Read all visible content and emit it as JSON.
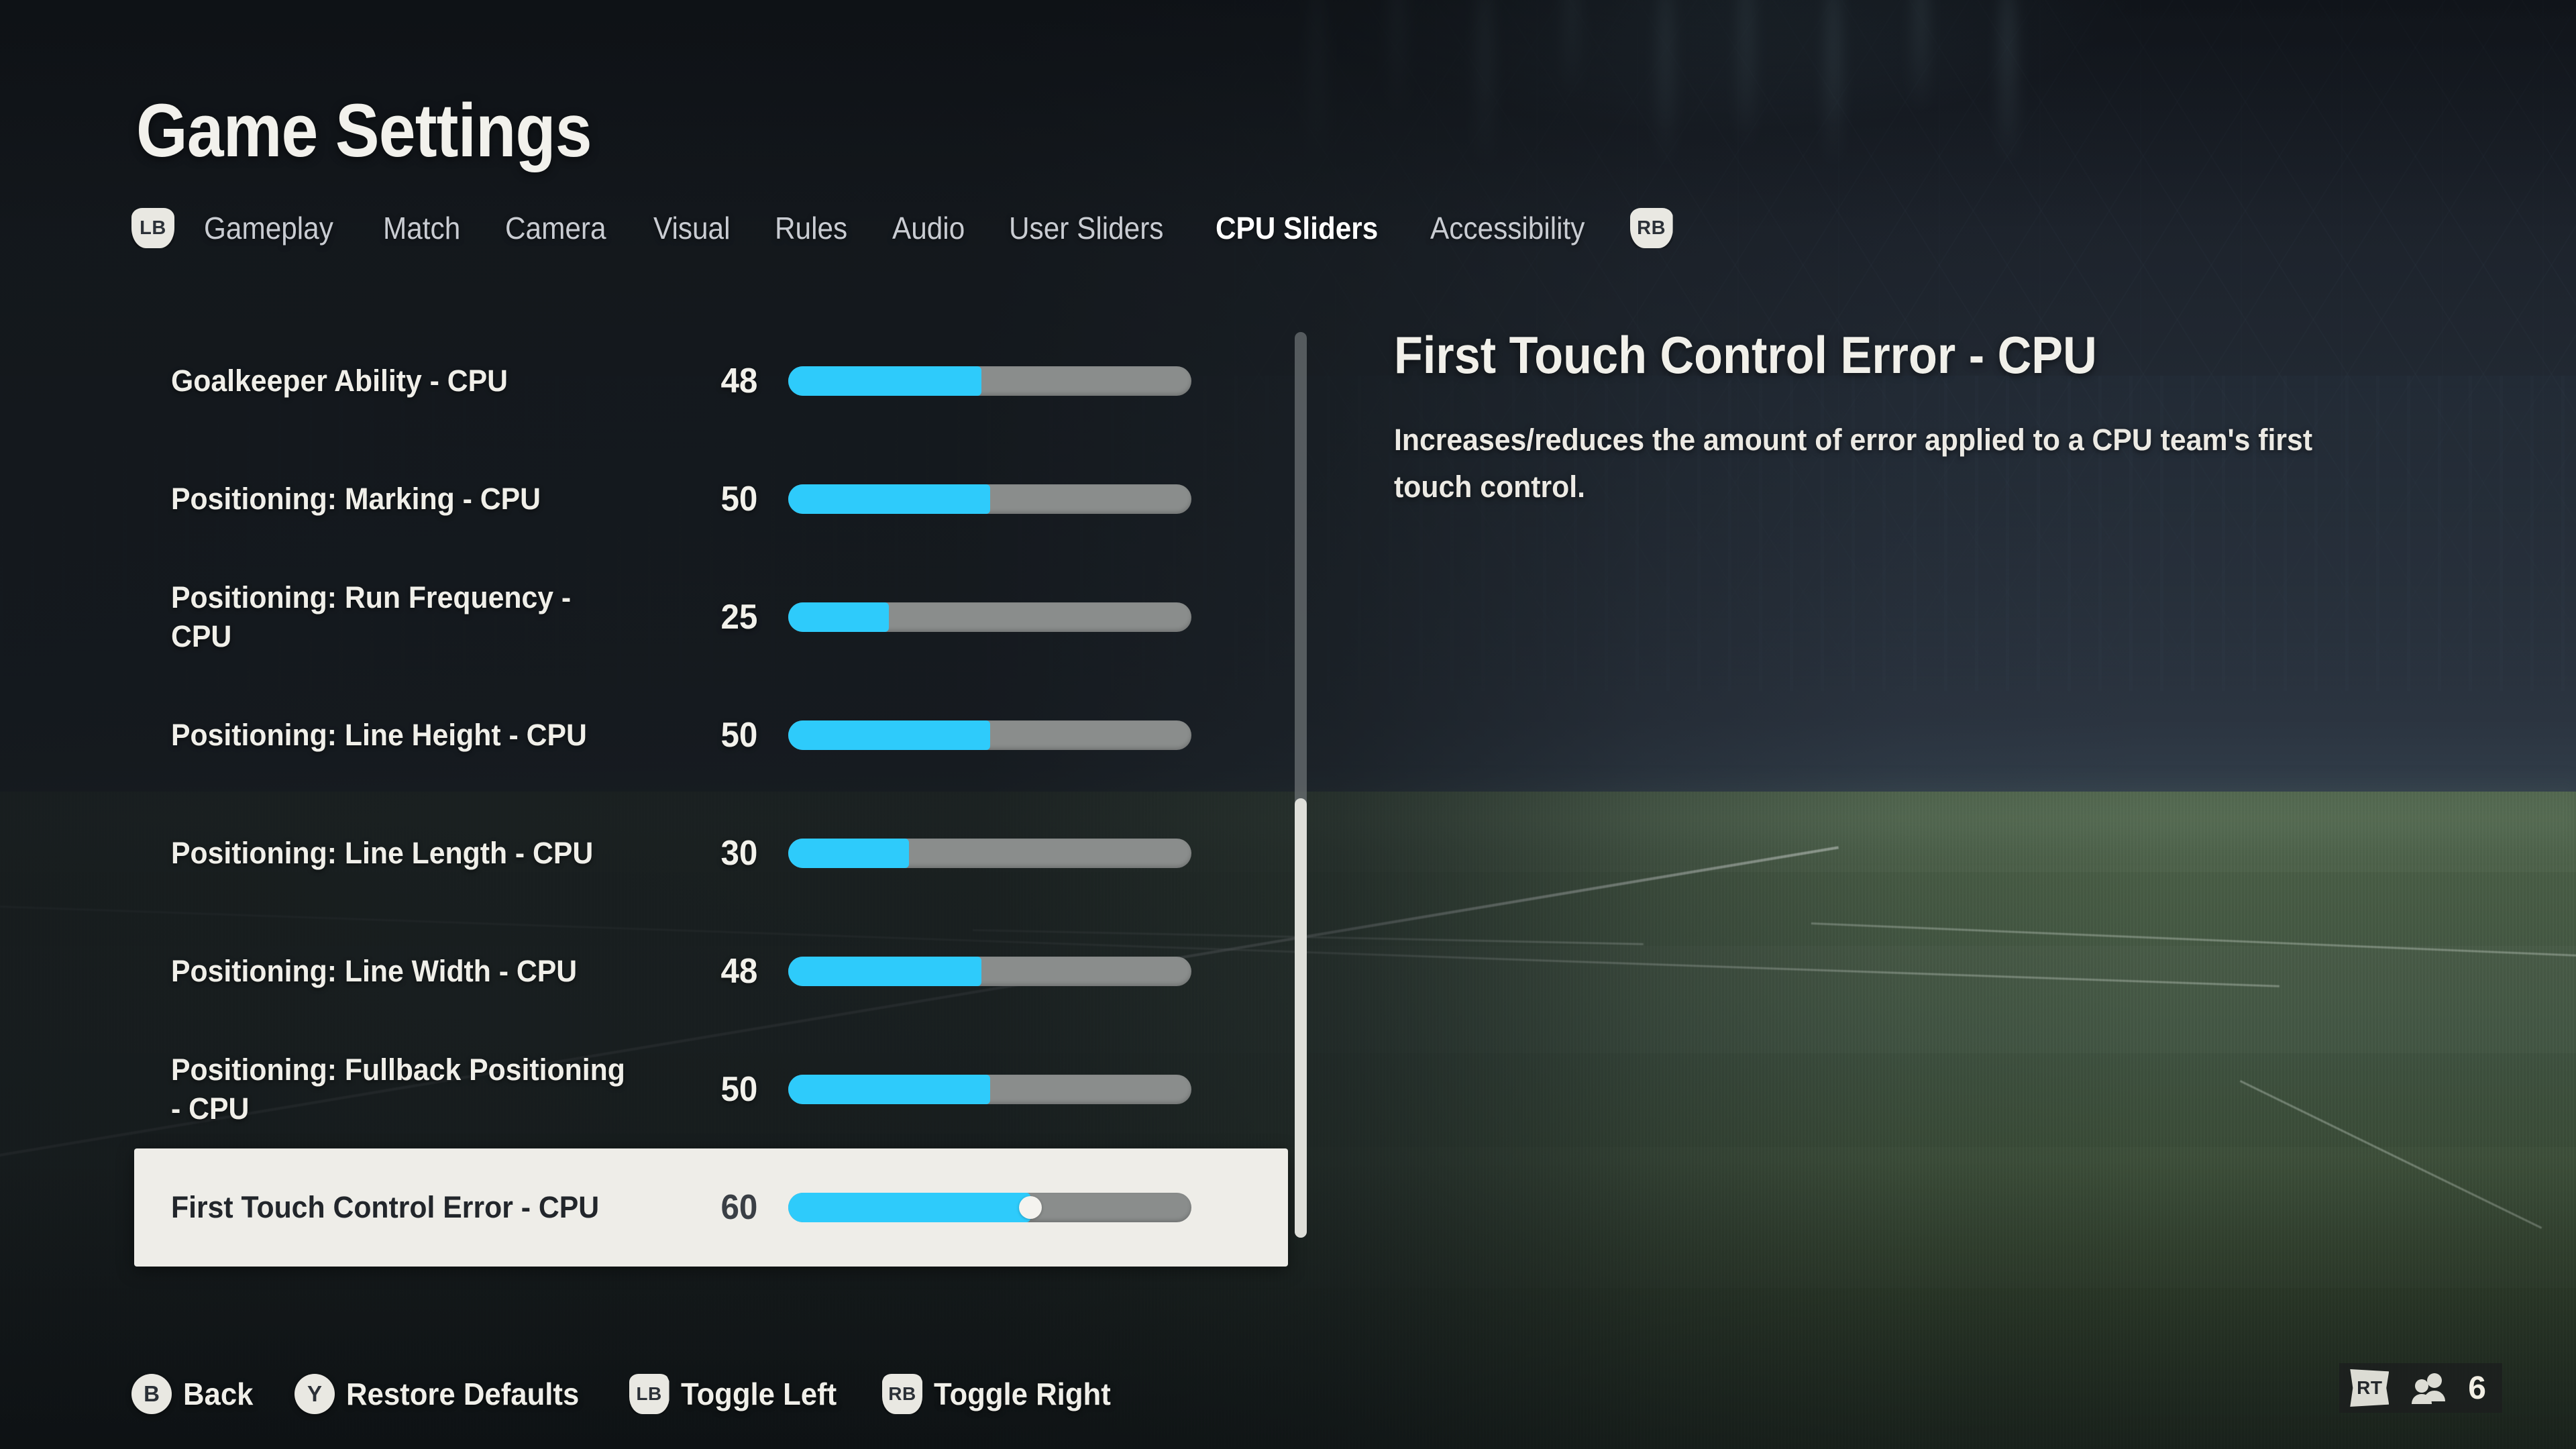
{
  "header": {
    "title": "Game Settings"
  },
  "tabs": {
    "left_bumper": "LB",
    "right_bumper": "RB",
    "items": [
      {
        "label": "Gameplay",
        "active": false
      },
      {
        "label": "Match",
        "active": false
      },
      {
        "label": "Camera",
        "active": false
      },
      {
        "label": "Visual",
        "active": false
      },
      {
        "label": "Rules",
        "active": false
      },
      {
        "label": "Audio",
        "active": false
      },
      {
        "label": "User Sliders",
        "active": false
      },
      {
        "label": "CPU Sliders",
        "active": true
      },
      {
        "label": "Accessibility",
        "active": false
      }
    ]
  },
  "settings": {
    "slider_min": 0,
    "slider_max": 100,
    "rows": [
      {
        "label": "Goalkeeper Ability - CPU",
        "value": "48",
        "percent": 48,
        "selected": false
      },
      {
        "label": "Positioning: Marking - CPU",
        "value": "50",
        "percent": 50,
        "selected": false
      },
      {
        "label": "Positioning: Run Frequency - CPU",
        "value": "25",
        "percent": 25,
        "selected": false
      },
      {
        "label": "Positioning: Line Height - CPU",
        "value": "50",
        "percent": 50,
        "selected": false
      },
      {
        "label": "Positioning: Line Length - CPU",
        "value": "30",
        "percent": 30,
        "selected": false
      },
      {
        "label": "Positioning: Line Width - CPU",
        "value": "48",
        "percent": 48,
        "selected": false
      },
      {
        "label": "Positioning: Fullback Positioning - CPU",
        "value": "50",
        "percent": 50,
        "selected": false
      },
      {
        "label": "First Touch Control Error - CPU",
        "value": "60",
        "percent": 60,
        "selected": true
      }
    ]
  },
  "detail": {
    "title": "First Touch Control Error - CPU",
    "description": "Increases/reduces the amount of error applied to a CPU team's first touch control."
  },
  "footer": {
    "hints": [
      {
        "glyph": "B",
        "shape": "round",
        "label": "Back"
      },
      {
        "glyph": "Y",
        "shape": "round",
        "label": "Restore Defaults"
      },
      {
        "glyph": "LB",
        "shape": "shoulder",
        "label": "Toggle Left"
      },
      {
        "glyph": "RB",
        "shape": "shoulder",
        "label": "Toggle Right"
      }
    ],
    "players": {
      "trigger": "RT",
      "count": "6"
    }
  },
  "colors": {
    "slider_fill": "#2ecbfb",
    "slider_track": "#8a8d8c",
    "selected_row_bg": "#eeedE8",
    "text_primary": "#f0efe9"
  }
}
